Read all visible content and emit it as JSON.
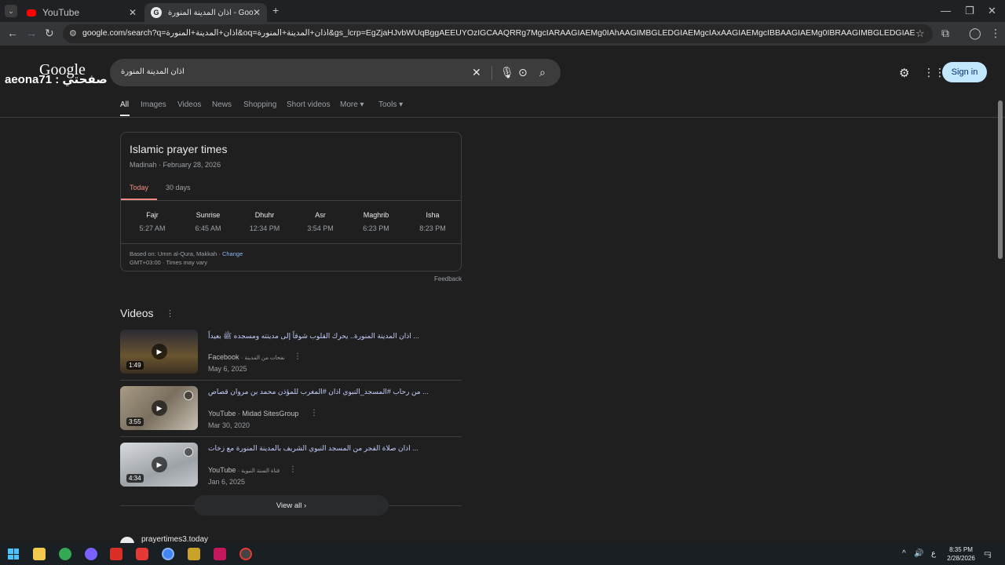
{
  "browser": {
    "tabs": [
      {
        "title": "YouTube",
        "active": false
      },
      {
        "title": "اذان المدينة المنورة - Google Search",
        "active": true
      }
    ],
    "new_tab_label": "+",
    "address": "google.com/search?q=اذان+المدينة+المنورة&oq=اذان+المدينة+المنورة&gs_lcrp=EgZjaHJvbWUqBggAEEUYOzIGCAAQRRg7MgcIARAAGIAEMg0IAhAAGIMBGLEDGIAEMgcIAxAAGIAEMgcIBBAAGIAEMg0IBRAAGIMBGLEDGIAEMgYIBhBFGDkyBggHEEUYPNIBBzc2OGowajeoAgCw..."
  },
  "logo": {
    "google": "Google",
    "overlay": "aeona71 : صفحتي"
  },
  "search": {
    "query": "اذان المدينة المنورة"
  },
  "header": {
    "sign_in": "Sign in"
  },
  "filters": {
    "tabs": [
      "All",
      "Images",
      "Videos",
      "News",
      "Shopping",
      "Short videos",
      "More ▾",
      "Tools ▾"
    ]
  },
  "prayer_card": {
    "title": "Islamic prayer times",
    "subtitle": "Madinah · February 28, 2026",
    "tabs": [
      "Today",
      "30 days"
    ],
    "times": [
      {
        "name": "Fajr",
        "time": "5:27 AM"
      },
      {
        "name": "Sunrise",
        "time": "6:45 AM"
      },
      {
        "name": "Dhuhr",
        "time": "12:34 PM"
      },
      {
        "name": "Asr",
        "time": "3:54 PM"
      },
      {
        "name": "Maghrib",
        "time": "6:23 PM"
      },
      {
        "name": "Isha",
        "time": "8:23 PM"
      }
    ],
    "based_on": "Based on: Umm al-Qura, Makkah · ",
    "change": "Change",
    "gmt": "GMT+03:00 · Times may vary",
    "feedback": "Feedback"
  },
  "videos": {
    "heading": "Videos",
    "items": [
      {
        "title": "اذان المدينة المنورة.. يحرك القلوب شوقاً إلى مدينته ومسجده ﷺ بعيداً ...",
        "source": "Facebook",
        "channel": "· نفحات من المدينة",
        "date": "May 6, 2025",
        "duration": "1:49",
        "thumb_color": "#5a4a2e"
      },
      {
        "title": "من رحاب #المسجد_النبوي اذان #المغرب للمؤذن محمد بن مروان قصاص ...",
        "source": "YouTube",
        "channel": "· Midad SitesGroup",
        "date": "Mar 30, 2020",
        "duration": "3:55",
        "thumb_color": "#8a7f6e"
      },
      {
        "title": "اذان صلاة الفجر من المسجد النبوي الشريف بالمدينة المنورة مع زخات ...",
        "source": "YouTube",
        "channel": "· قناة السنة النبوية",
        "date": "Jan 6, 2025",
        "duration": "4:34",
        "thumb_color": "#b8bcc0"
      }
    ],
    "view_all": "View all ›"
  },
  "next_result": {
    "site": "prayertimes3.today"
  },
  "taskbar": {
    "clock_time": "8:35 PM",
    "clock_date": "2/28/2026",
    "lang": "ع",
    "notif_count": "3"
  },
  "colors": {
    "accent": "#8ab4f8",
    "prayer_today": "#f28b82",
    "signin_bg": "#c2e7ff"
  }
}
